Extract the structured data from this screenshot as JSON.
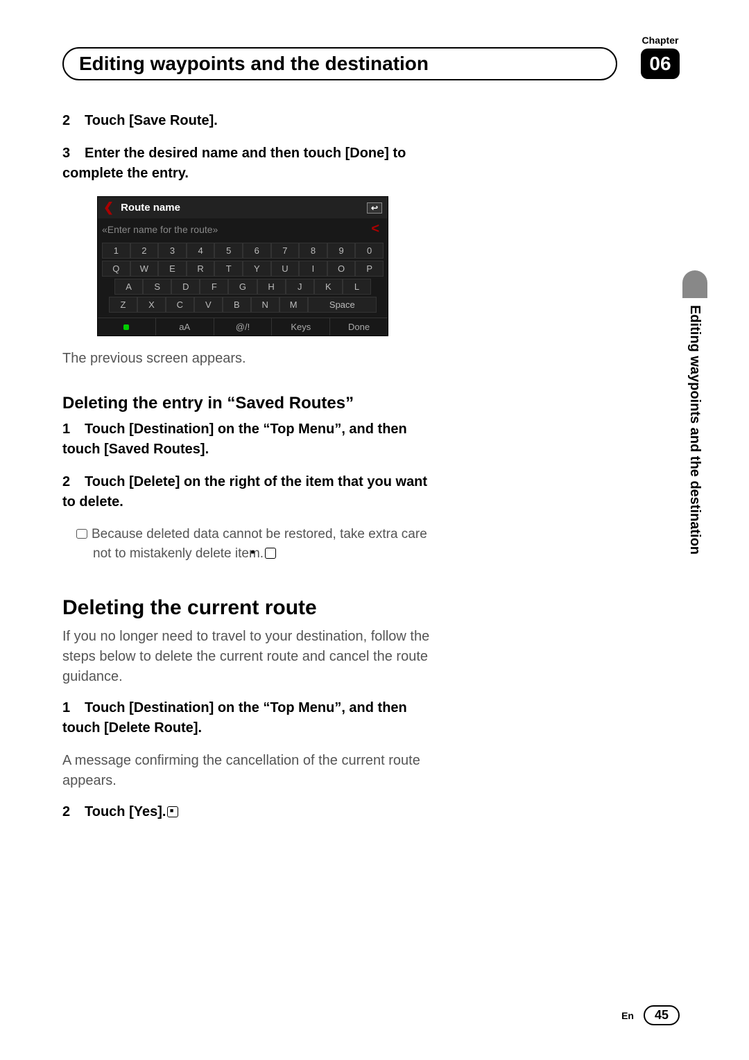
{
  "header": {
    "title": "Editing waypoints and the destination",
    "chapter_label": "Chapter",
    "chapter_num": "06"
  },
  "side_tab": "Editing waypoints and the destination",
  "steps_top": {
    "s2": "Touch [Save Route].",
    "s3": "Enter the desired name and then touch [Done] to complete the entry."
  },
  "figure": {
    "title": "Route name",
    "placeholder": "«Enter name for the route»",
    "row1": [
      "1",
      "2",
      "3",
      "4",
      "5",
      "6",
      "7",
      "8",
      "9",
      "0"
    ],
    "row2": [
      "Q",
      "W",
      "E",
      "R",
      "T",
      "Y",
      "U",
      "I",
      "O",
      "P"
    ],
    "row3": [
      "A",
      "S",
      "D",
      "F",
      "G",
      "H",
      "J",
      "K",
      "L"
    ],
    "row4": [
      "Z",
      "X",
      "C",
      "V",
      "B",
      "N",
      "M"
    ],
    "space": "Space",
    "aA": "aA",
    "sym": "@/!",
    "keys": "Keys",
    "done": "Done"
  },
  "after_fig": "The previous screen appears.",
  "section_delete_entry": {
    "heading_a": "Deleting the entry in ",
    "heading_b": "“Saved Routes”",
    "s1": "Touch [Destination] on the “Top Menu”, and then touch [Saved Routes].",
    "s2": "Touch [Delete] on the right of the item that you want to delete.",
    "note": "Because deleted data cannot be restored, take extra care not to mistakenly delete item."
  },
  "section_delete_route": {
    "heading": "Deleting the current route",
    "intro": "If you no longer need to travel to your destination, follow the steps below to delete the current route and cancel the route guidance.",
    "s1": "Touch [Destination] on the “Top Menu”, and then touch [Delete Route].",
    "s1_after": "A message confirming the cancellation of the current route appears.",
    "s2": "Touch [Yes]."
  },
  "footer": {
    "lang": "En",
    "page": "45"
  }
}
